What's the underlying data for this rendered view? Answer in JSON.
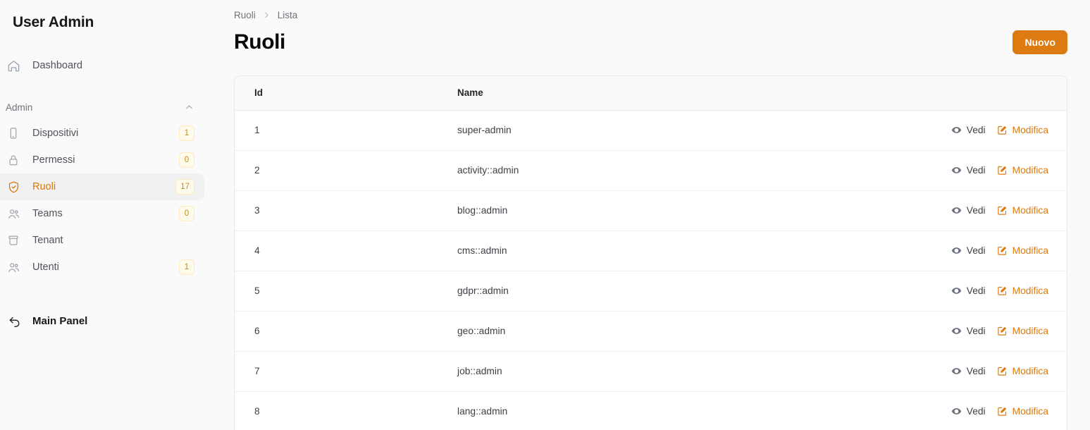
{
  "brand": {
    "title": "User Admin"
  },
  "sidebar": {
    "top_items": [
      {
        "label": "Dashboard",
        "icon": "home-icon",
        "badge": null,
        "active": false
      }
    ],
    "section": {
      "label": "Admin",
      "chevron": "chevron-up-icon",
      "expanded": true
    },
    "items": [
      {
        "label": "Dispositivi",
        "icon": "device-phone-icon",
        "badge": "1",
        "active": false
      },
      {
        "label": "Permessi",
        "icon": "lock-icon",
        "badge": "0",
        "active": false
      },
      {
        "label": "Ruoli",
        "icon": "shield-check-icon",
        "badge": "17",
        "active": true
      },
      {
        "label": "Teams",
        "icon": "users-icon",
        "badge": "0",
        "active": false
      },
      {
        "label": "Tenant",
        "icon": "archive-box-icon",
        "badge": null,
        "active": false
      },
      {
        "label": "Utenti",
        "icon": "users-icon",
        "badge": "1",
        "active": false
      }
    ],
    "footer": {
      "label": "Main Panel",
      "icon": "arrow-uturn-left-icon"
    }
  },
  "header": {
    "breadcrumb": [
      "Ruoli",
      "Lista"
    ],
    "breadcrumb_separator": "chevron-right-icon",
    "title": "Ruoli",
    "new_button": "Nuovo"
  },
  "table": {
    "columns": [
      "Id",
      "Name",
      ""
    ],
    "action_view": "Vedi",
    "action_edit": "Modifica",
    "action_view_icon": "eye-icon",
    "action_edit_icon": "pencil-square-icon",
    "rows": [
      {
        "id": "1",
        "name": "super-admin"
      },
      {
        "id": "2",
        "name": "activity::admin"
      },
      {
        "id": "3",
        "name": "blog::admin"
      },
      {
        "id": "4",
        "name": "cms::admin"
      },
      {
        "id": "5",
        "name": "gdpr::admin"
      },
      {
        "id": "6",
        "name": "geo::admin"
      },
      {
        "id": "7",
        "name": "job::admin"
      },
      {
        "id": "8",
        "name": "lang::admin"
      }
    ]
  },
  "colors": {
    "accent": "#dd7a11",
    "badge_bg": "#fffbeb",
    "badge_text": "#c98a16",
    "page_bg": "#fafafa",
    "card_bg": "#ffffff"
  }
}
